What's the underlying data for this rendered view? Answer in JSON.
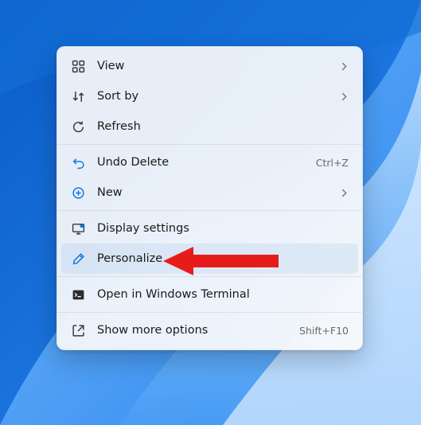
{
  "menu": {
    "items": [
      {
        "label": "View",
        "icon": "view",
        "submenu": true
      },
      {
        "label": "Sort by",
        "icon": "sort",
        "submenu": true
      },
      {
        "label": "Refresh",
        "icon": "refresh"
      }
    ],
    "items2": [
      {
        "label": "Undo Delete",
        "icon": "undo",
        "shortcut": "Ctrl+Z"
      },
      {
        "label": "New",
        "icon": "new",
        "submenu": true
      }
    ],
    "items3": [
      {
        "label": "Display settings",
        "icon": "display"
      },
      {
        "label": "Personalize",
        "icon": "personalize",
        "hovered": true
      }
    ],
    "items4": [
      {
        "label": "Open in Windows Terminal",
        "icon": "terminal"
      }
    ],
    "items5": [
      {
        "label": "Show more options",
        "icon": "more",
        "shortcut": "Shift+F10"
      }
    ]
  }
}
